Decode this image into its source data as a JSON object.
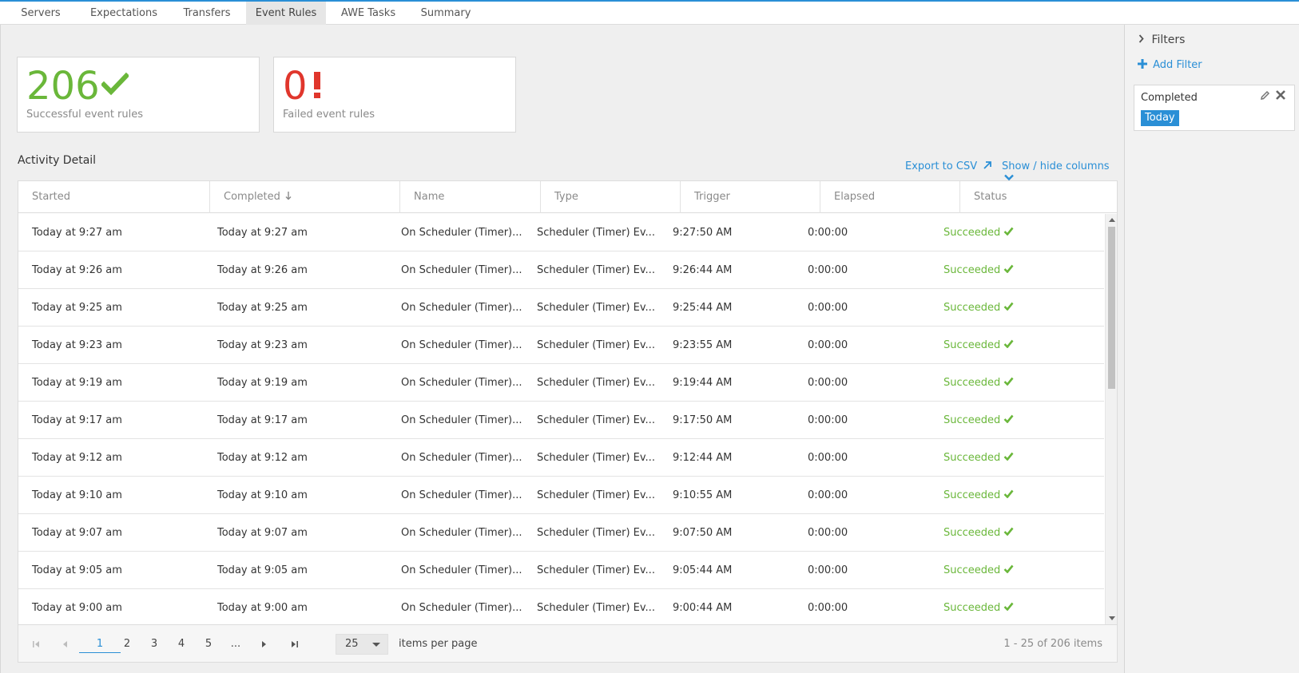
{
  "tabs": [
    {
      "label": "Servers",
      "active": false
    },
    {
      "label": "Expectations",
      "active": false
    },
    {
      "label": "Transfers",
      "active": false
    },
    {
      "label": "Event Rules",
      "active": true
    },
    {
      "label": "AWE Tasks",
      "active": false
    },
    {
      "label": "Summary",
      "active": false
    }
  ],
  "summary": {
    "success": {
      "count": "206",
      "label": "Successful event rules",
      "color": "#6ab73a",
      "icon": "check-icon"
    },
    "failed": {
      "count": "0",
      "label": "Failed event rules",
      "color": "#e0362c",
      "icon": "exclamation-icon"
    }
  },
  "activity": {
    "title": "Activity Detail",
    "export_label": "Export to CSV",
    "columns_label": "Show / hide columns"
  },
  "table": {
    "headers": [
      "Started",
      "Completed",
      "Name",
      "Type",
      "Trigger",
      "Elapsed",
      "Status"
    ],
    "rows": [
      {
        "started": "Today at 9:27 am",
        "completed": "Today at 9:27 am",
        "name": "On Scheduler (Timer)...",
        "type": "Scheduler (Timer) Ev...",
        "trigger": "9:27:50 AM",
        "elapsed": "0:00:00",
        "status": "Succeeded"
      },
      {
        "started": "Today at 9:26 am",
        "completed": "Today at 9:26 am",
        "name": "On Scheduler (Timer)...",
        "type": "Scheduler (Timer) Ev...",
        "trigger": "9:26:44 AM",
        "elapsed": "0:00:00",
        "status": "Succeeded"
      },
      {
        "started": "Today at 9:25 am",
        "completed": "Today at 9:25 am",
        "name": "On Scheduler (Timer)...",
        "type": "Scheduler (Timer) Ev...",
        "trigger": "9:25:44 AM",
        "elapsed": "0:00:00",
        "status": "Succeeded"
      },
      {
        "started": "Today at 9:23 am",
        "completed": "Today at 9:23 am",
        "name": "On Scheduler (Timer)...",
        "type": "Scheduler (Timer) Ev...",
        "trigger": "9:23:55 AM",
        "elapsed": "0:00:00",
        "status": "Succeeded"
      },
      {
        "started": "Today at 9:19 am",
        "completed": "Today at 9:19 am",
        "name": "On Scheduler (Timer)...",
        "type": "Scheduler (Timer) Ev...",
        "trigger": "9:19:44 AM",
        "elapsed": "0:00:00",
        "status": "Succeeded"
      },
      {
        "started": "Today at 9:17 am",
        "completed": "Today at 9:17 am",
        "name": "On Scheduler (Timer)...",
        "type": "Scheduler (Timer) Ev...",
        "trigger": "9:17:50 AM",
        "elapsed": "0:00:00",
        "status": "Succeeded"
      },
      {
        "started": "Today at 9:12 am",
        "completed": "Today at 9:12 am",
        "name": "On Scheduler (Timer)...",
        "type": "Scheduler (Timer) Ev...",
        "trigger": "9:12:44 AM",
        "elapsed": "0:00:00",
        "status": "Succeeded"
      },
      {
        "started": "Today at 9:10 am",
        "completed": "Today at 9:10 am",
        "name": "On Scheduler (Timer)...",
        "type": "Scheduler (Timer) Ev...",
        "trigger": "9:10:55 AM",
        "elapsed": "0:00:00",
        "status": "Succeeded"
      },
      {
        "started": "Today at 9:07 am",
        "completed": "Today at 9:07 am",
        "name": "On Scheduler (Timer)...",
        "type": "Scheduler (Timer) Ev...",
        "trigger": "9:07:50 AM",
        "elapsed": "0:00:00",
        "status": "Succeeded"
      },
      {
        "started": "Today at 9:05 am",
        "completed": "Today at 9:05 am",
        "name": "On Scheduler (Timer)...",
        "type": "Scheduler (Timer) Ev...",
        "trigger": "9:05:44 AM",
        "elapsed": "0:00:00",
        "status": "Succeeded"
      },
      {
        "started": "Today at 9:00 am",
        "completed": "Today at 9:00 am",
        "name": "On Scheduler (Timer)...",
        "type": "Scheduler (Timer) Ev...",
        "trigger": "9:00:44 AM",
        "elapsed": "0:00:00",
        "status": "Succeeded"
      }
    ]
  },
  "pagination": {
    "pages": [
      "1",
      "2",
      "3",
      "4",
      "5",
      "..."
    ],
    "current": "1",
    "page_size": "25",
    "items_per_page_label": "items per page",
    "info": "1 - 25 of 206 items"
  },
  "filters": {
    "title": "Filters",
    "add_label": "Add Filter",
    "chip": {
      "title": "Completed",
      "value": "Today"
    }
  },
  "colors": {
    "accent": "#2a8fd6",
    "success": "#6ab73a",
    "danger": "#e0362c"
  }
}
